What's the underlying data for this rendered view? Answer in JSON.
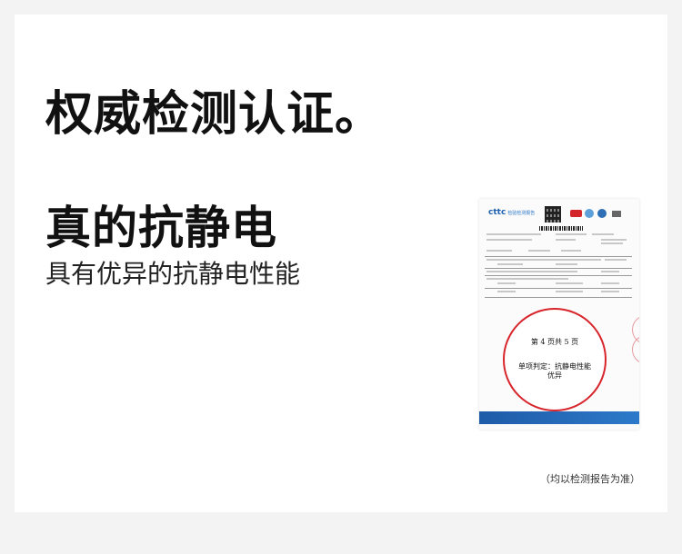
{
  "headline": "权威检测认证。",
  "feature": {
    "title": "真的抗静电",
    "description": "具有优异的抗静电性能"
  },
  "certificate": {
    "logo_text": "cttc",
    "logo_sub": "检验检测报告",
    "stamp_page": "第 4 页共 5 页",
    "stamp_verdict": "单项判定：抗静电性能优异",
    "colors": {
      "stamp": "#d8242b",
      "footer": "#1e5ba8",
      "logo": "#1b5fae"
    }
  },
  "note": "（均以检测报告为准）"
}
